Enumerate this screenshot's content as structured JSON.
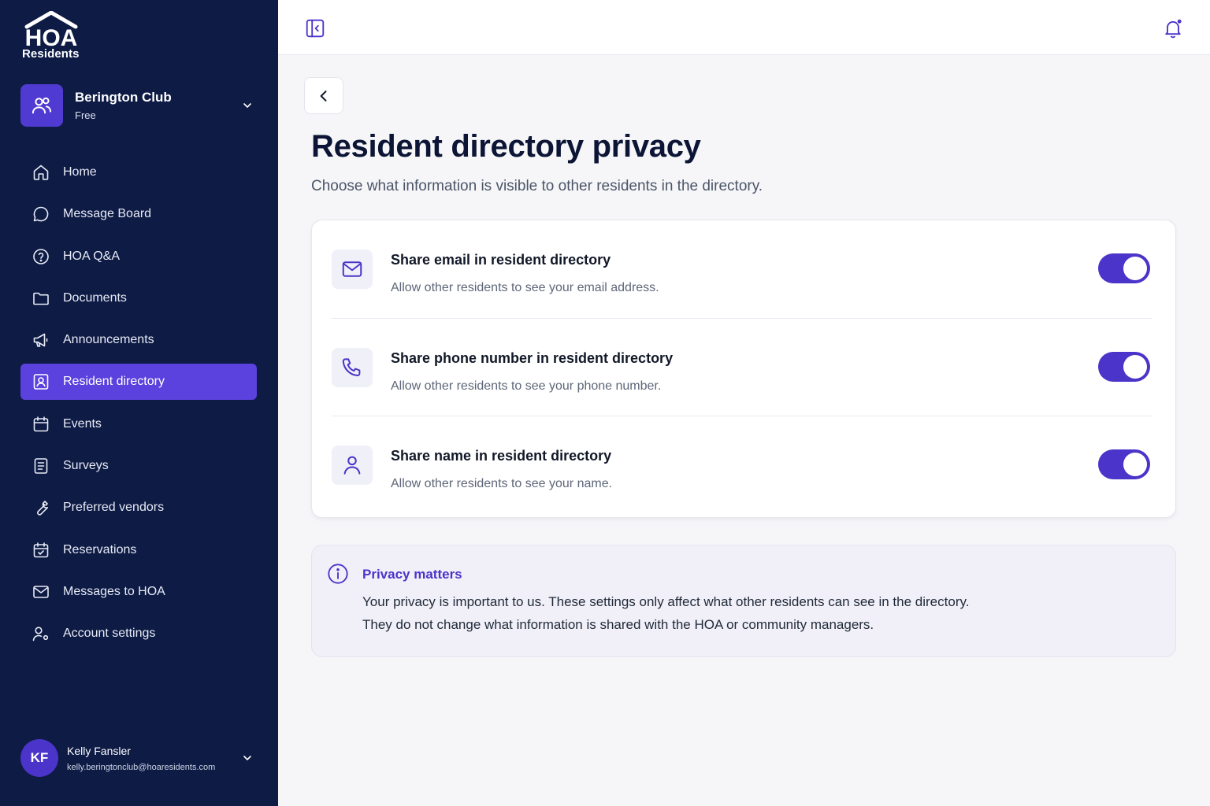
{
  "brand": {
    "logo_word": "HOA",
    "logo_sub": "Residents"
  },
  "org": {
    "name": "Berington Club",
    "plan": "Free"
  },
  "nav": [
    {
      "label": "Home",
      "icon": "home-icon"
    },
    {
      "label": "Message Board",
      "icon": "chat-bubble-icon"
    },
    {
      "label": "HOA Q&A",
      "icon": "question-circle-icon"
    },
    {
      "label": "Documents",
      "icon": "folder-icon"
    },
    {
      "label": "Announcements",
      "icon": "megaphone-icon"
    },
    {
      "label": "Resident directory",
      "icon": "contact-card-icon",
      "active": true
    },
    {
      "label": "Events",
      "icon": "calendar-icon"
    },
    {
      "label": "Surveys",
      "icon": "document-list-icon"
    },
    {
      "label": "Preferred vendors",
      "icon": "wrench-icon"
    },
    {
      "label": "Reservations",
      "icon": "calendar-check-icon"
    },
    {
      "label": "Messages to HOA",
      "icon": "mail-icon"
    },
    {
      "label": "Account settings",
      "icon": "user-gear-icon"
    }
  ],
  "user": {
    "initials": "KF",
    "name": "Kelly Fansler",
    "email": "kelly.beringtonclub@hoaresidents.com"
  },
  "page": {
    "title": "Resident directory privacy",
    "subtitle": "Choose what information is visible to other residents in the directory."
  },
  "settings": [
    {
      "title": "Share email in resident directory",
      "description": "Allow other residents to see your email address.",
      "enabled": true,
      "icon": "mail-icon"
    },
    {
      "title": "Share phone number in resident directory",
      "description": "Allow other residents to see your phone number.",
      "enabled": true,
      "icon": "phone-icon"
    },
    {
      "title": "Share name in resident directory",
      "description": "Allow other residents to see your name.",
      "enabled": true,
      "icon": "person-icon"
    }
  ],
  "info": {
    "title": "Privacy matters",
    "line1": "Your privacy is important to us. These settings only affect what other residents can see in the directory.",
    "line2": "They do not change what information is shared with the HOA or community managers."
  },
  "colors": {
    "sidebar": "#0d1b45",
    "accent": "#4b34c9",
    "active_nav": "#5b41dd",
    "background": "#f6f6f9"
  }
}
